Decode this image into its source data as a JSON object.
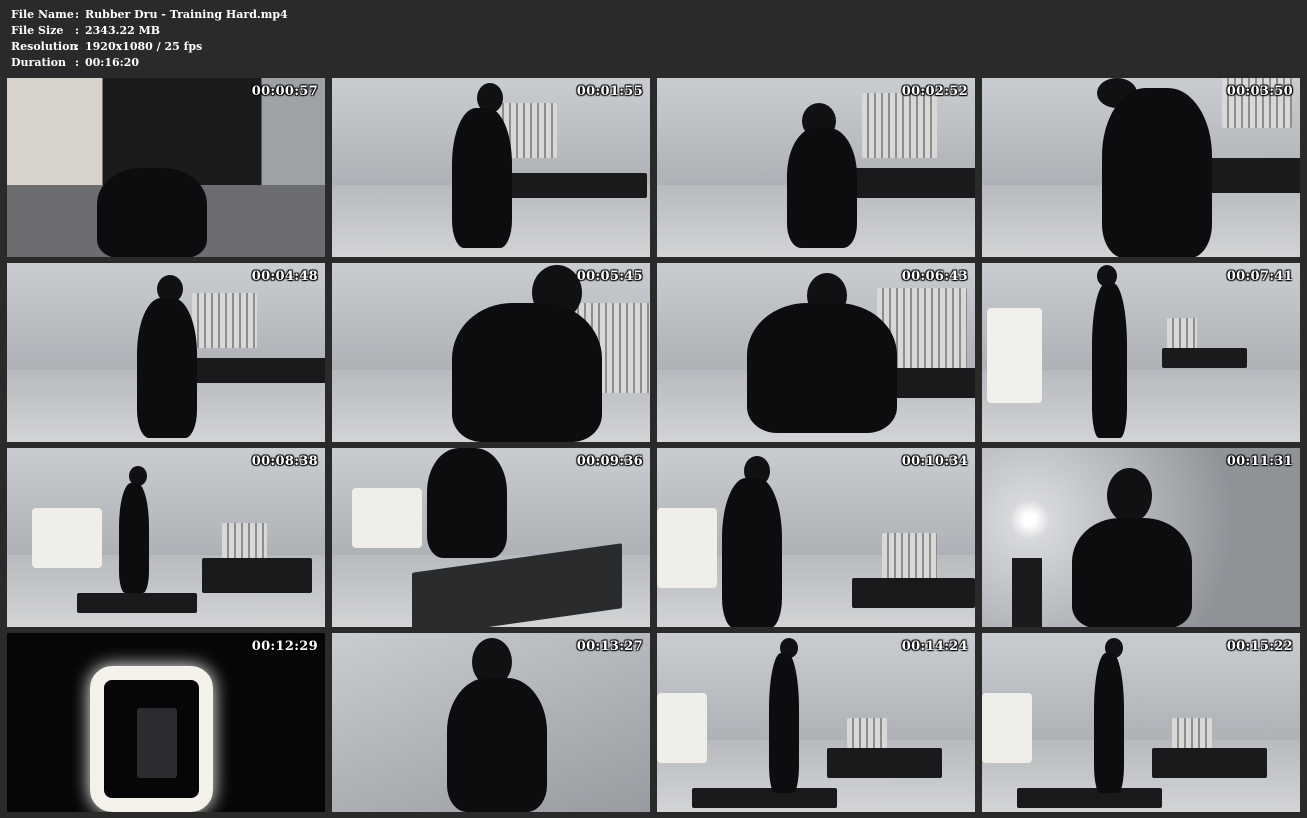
{
  "meta": {
    "file_name_label": "File Name",
    "file_name": "Rubber Dru - Training Hard.mp4",
    "file_size_label": "File Size",
    "file_size": "2343.22 MB",
    "resolution_label": "Resolution",
    "resolution": "1920x1080 / 25 fps",
    "duration_label": "Duration",
    "duration": "00:16:20",
    "separator": ":"
  },
  "thumbnails": [
    {
      "timestamp": "00:00:57"
    },
    {
      "timestamp": "00:01:55"
    },
    {
      "timestamp": "00:02:52"
    },
    {
      "timestamp": "00:03:50"
    },
    {
      "timestamp": "00:04:48"
    },
    {
      "timestamp": "00:05:45"
    },
    {
      "timestamp": "00:06:43"
    },
    {
      "timestamp": "00:07:41"
    },
    {
      "timestamp": "00:08:38"
    },
    {
      "timestamp": "00:09:36"
    },
    {
      "timestamp": "00:10:34"
    },
    {
      "timestamp": "00:11:31"
    },
    {
      "timestamp": "00:12:29"
    },
    {
      "timestamp": "00:13:27"
    },
    {
      "timestamp": "00:14:24"
    },
    {
      "timestamp": "00:15:22"
    }
  ],
  "colors": {
    "background": "#2a2a2a",
    "text": "#ffffff"
  }
}
